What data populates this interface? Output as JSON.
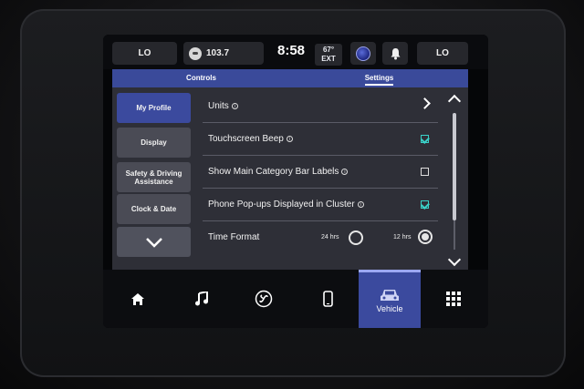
{
  "status_bar": {
    "left_climate": "LO",
    "radio_station": "103.7",
    "time": "8:58",
    "temperature": "67°",
    "temperature_label": "EXT",
    "right_climate": "LO"
  },
  "tabs": [
    {
      "label": "Controls",
      "active": false
    },
    {
      "label": "Settings",
      "active": true
    }
  ],
  "sidebar": {
    "items": [
      {
        "label": "My Profile",
        "active": true
      },
      {
        "label": "Display",
        "active": false
      },
      {
        "label": "Safety & Driving Assistance",
        "active": false
      },
      {
        "label": "Clock & Date",
        "active": false
      }
    ],
    "more_icon": "chevron-down-icon"
  },
  "settings": {
    "units": {
      "label": "Units",
      "icon": "chevron-right-icon"
    },
    "touchscreen_beep": {
      "label": "Touchscreen Beep",
      "checked": true
    },
    "category_bar_labels": {
      "label": "Show Main Category Bar Labels",
      "checked": false
    },
    "phone_popups": {
      "label": "Phone Pop-ups Displayed in Cluster",
      "checked": true
    },
    "time_format": {
      "label": "Time Format",
      "option_24": "24 hrs",
      "option_12": "12 hrs",
      "selected": "12 hrs"
    }
  },
  "nav": {
    "items": [
      {
        "icon": "home-icon"
      },
      {
        "icon": "music-icon"
      },
      {
        "icon": "climate-fan-icon"
      },
      {
        "icon": "phone-icon"
      },
      {
        "icon": "vehicle-icon",
        "label": "Vehicle",
        "active": true
      },
      {
        "icon": "apps-grid-icon"
      }
    ]
  },
  "colors": {
    "accent": "#3b4a9e",
    "check_color": "#3ad1c8",
    "panel_bg": "#2e2f37"
  }
}
